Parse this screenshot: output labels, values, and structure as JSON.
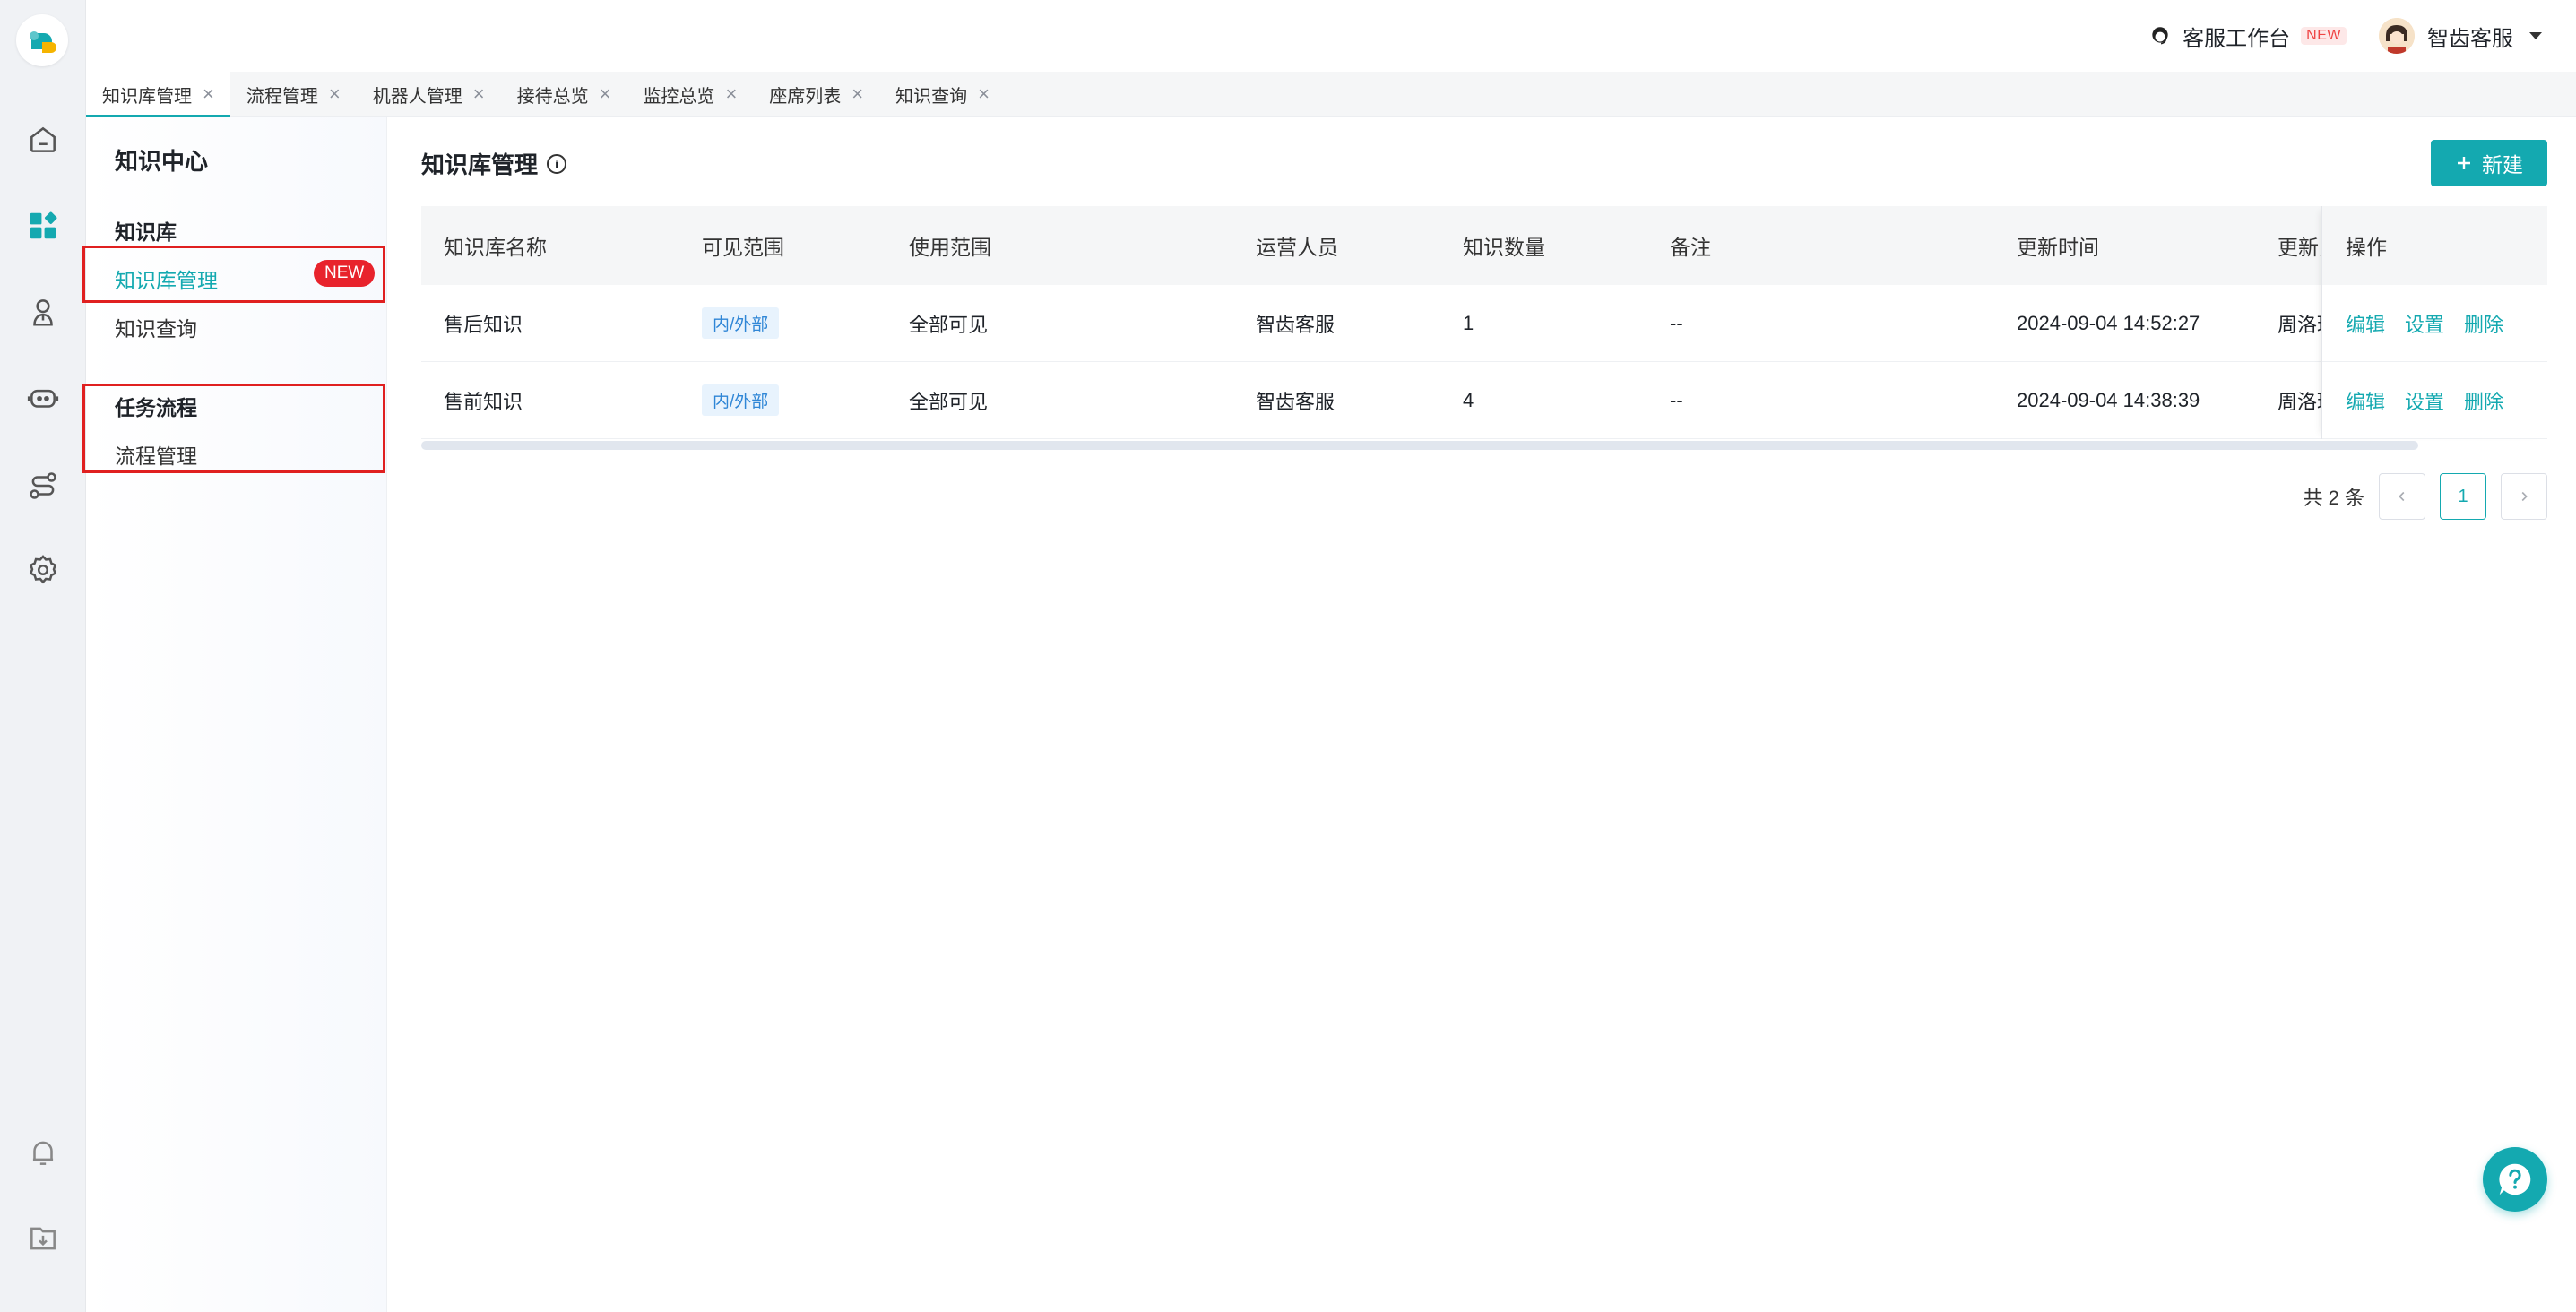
{
  "topbar": {
    "workbench_label": "客服工作台",
    "workbench_badge": "NEW",
    "user_name": "智齿客服"
  },
  "tabs": [
    {
      "label": "知识库管理",
      "active": true
    },
    {
      "label": "流程管理"
    },
    {
      "label": "机器人管理"
    },
    {
      "label": "接待总览"
    },
    {
      "label": "监控总览"
    },
    {
      "label": "座席列表"
    },
    {
      "label": "知识查询"
    }
  ],
  "rail": {
    "icons": [
      "home-icon",
      "apps-icon",
      "user-icon",
      "robot-icon",
      "flow-icon",
      "settings-icon",
      "bell-icon",
      "download-icon"
    ],
    "accent": "#14a9b0"
  },
  "subnav": {
    "title": "知识中心",
    "groups": [
      {
        "title": "知识库",
        "items": [
          {
            "label": "知识库管理",
            "badge": "NEW",
            "active": true
          },
          {
            "label": "知识查询"
          }
        ]
      },
      {
        "title": "任务流程",
        "items": [
          {
            "label": "流程管理"
          }
        ]
      }
    ]
  },
  "main": {
    "title": "知识库管理",
    "new_button": "新建",
    "columns": [
      "知识库名称",
      "可见范围",
      "使用范围",
      "运营人员",
      "知识数量",
      "备注",
      "更新时间",
      "更新人",
      "操作"
    ],
    "rows": [
      {
        "name": "售后知识",
        "visibility": "内/外部",
        "usage": "全部可见",
        "operator": "智齿客服",
        "count": "1",
        "remark": "--",
        "updated": "2024-09-04 14:52:27",
        "updater": "周洛瑶"
      },
      {
        "name": "售前知识",
        "visibility": "内/外部",
        "usage": "全部可见",
        "operator": "智齿客服",
        "count": "4",
        "remark": "--",
        "updated": "2024-09-04 14:38:39",
        "updater": "周洛瑶"
      }
    ],
    "actions": [
      "编辑",
      "设置",
      "删除"
    ]
  },
  "pagination": {
    "total_text": "共 2 条",
    "current_page": "1"
  },
  "colors": {
    "accent": "#14a9b0",
    "highlight_border": "#e02020",
    "new_badge": "#e8232c"
  }
}
